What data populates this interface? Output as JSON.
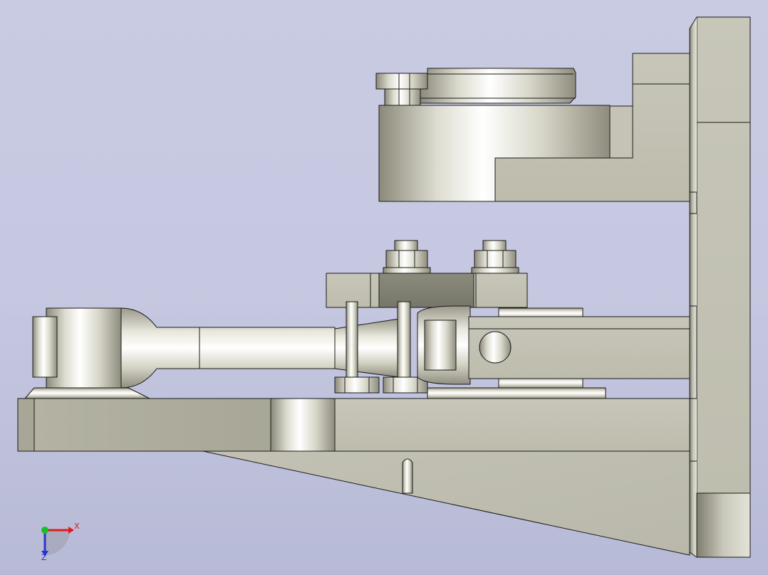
{
  "viewport": {
    "background_top": "#c9cbe3",
    "background_bottom": "#b7bad6"
  },
  "model": {
    "shaded_color": "#c2c1b3",
    "edge_color": "#1a1a1a"
  },
  "triad": {
    "x_label": "X",
    "z_label": "Z",
    "x_color": "#e21a1a",
    "y_color": "#17c02a",
    "z_color": "#2b34c9"
  }
}
